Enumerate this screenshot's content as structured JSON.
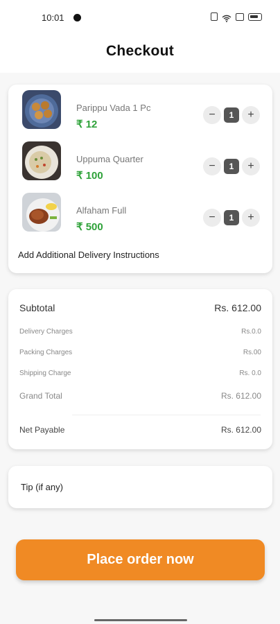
{
  "status_bar": {
    "time": "10:01",
    "icons": [
      "vibrate-icon",
      "wifi-icon",
      "nfc-icon",
      "battery-icon"
    ]
  },
  "header": {
    "title": "Checkout"
  },
  "cart": {
    "items": [
      {
        "name": "Parippu Vada 1 Pc",
        "price": "₹ 12",
        "qty": "1",
        "image": "fried-vada-plate"
      },
      {
        "name": "Uppuma Quarter",
        "price": "₹ 100",
        "qty": "1",
        "image": "uppuma-plate"
      },
      {
        "name": "Alfaham Full",
        "price": "₹ 500",
        "qty": "1",
        "image": "grilled-chicken-plate"
      }
    ],
    "minus_symbol": "−",
    "plus_symbol": "+",
    "instructions_label": "Add Additional Delivery Instructions"
  },
  "bill": {
    "subtotal_label": "Subtotal",
    "subtotal_value": "Rs. 612.00",
    "delivery_label": "Delivery Charges",
    "delivery_value": "Rs.0.0",
    "packing_label": "Packing Charges",
    "packing_value": "Rs.00",
    "shipping_label": "Shipping  Charge",
    "shipping_value": "Rs. 0.0",
    "grand_label": "Grand Total",
    "grand_value": "Rs. 612.00",
    "net_label": "Net Payable",
    "net_value": "Rs. 612.00"
  },
  "tip": {
    "label": "Tip (if any)"
  },
  "actions": {
    "place_order_label": "Place order now"
  },
  "colors": {
    "accent": "#f08a24",
    "price_green": "#2fa23a",
    "qty_badge": "#555555"
  }
}
